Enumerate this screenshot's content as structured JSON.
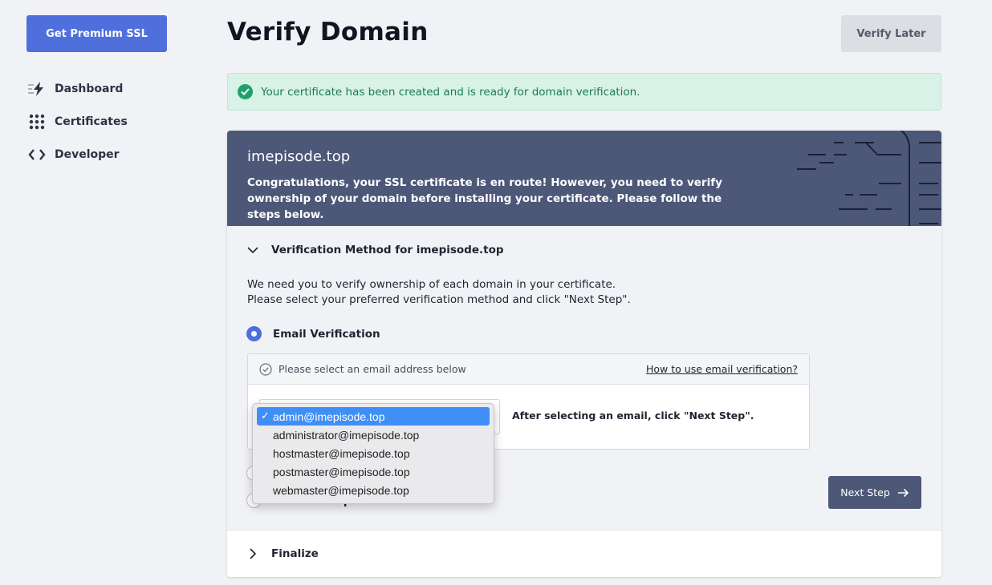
{
  "sidebar": {
    "premium_button": "Get Premium SSL",
    "items": [
      {
        "label": "Dashboard",
        "icon": "lightning-icon"
      },
      {
        "label": "Certificates",
        "icon": "grid-icon"
      },
      {
        "label": "Developer",
        "icon": "code-icon"
      }
    ]
  },
  "header": {
    "title": "Verify Domain",
    "verify_later": "Verify Later"
  },
  "alert": {
    "message": "Your certificate has been created and is ready for domain verification."
  },
  "hero": {
    "domain": "imepisode.top",
    "text": "Congratulations, your SSL certificate is en route! However, you need to verify ownership of your domain before installing your certificate. Please follow the steps below."
  },
  "verification": {
    "heading": "Verification Method for imepisode.top",
    "instruction_1": "We need you to verify ownership of each domain in your certificate.",
    "instruction_2": "Please select your preferred verification method and click \"Next Step\".",
    "email_option": "Email Verification",
    "email_hint": "Please select an email address below",
    "email_help_link": "How to use email verification?",
    "after_select": "After selecting an email, click \"Next Step\".",
    "http_option": "HTTP File Upload",
    "next_button": "Next Step"
  },
  "email_dropdown": {
    "selected": "admin@imepisode.top",
    "options": [
      "admin@imepisode.top",
      "administrator@imepisode.top",
      "hostmaster@imepisode.top",
      "postmaster@imepisode.top",
      "webmaster@imepisode.top"
    ]
  },
  "finalize": {
    "label": "Finalize"
  },
  "colors": {
    "primary": "#4f6fdd",
    "hero_bg": "#4d5878",
    "success_bg": "#d8f2e8",
    "success_text": "#1c7a55",
    "dropdown_highlight": "#3f8ff7"
  }
}
